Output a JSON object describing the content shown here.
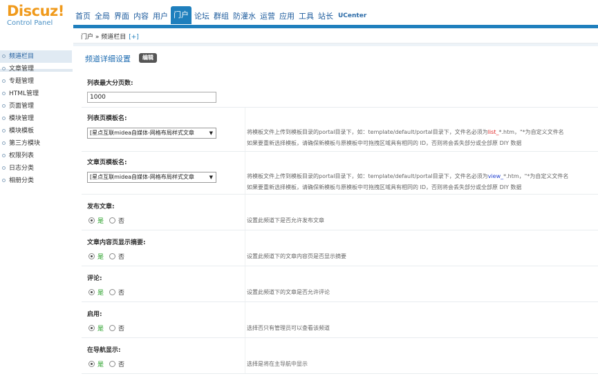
{
  "logo": {
    "text": "Discuz!",
    "subtitle": "Control Panel"
  },
  "topnav": [
    {
      "label": "首页",
      "active": false
    },
    {
      "label": "全局",
      "active": false
    },
    {
      "label": "界面",
      "active": false
    },
    {
      "label": "内容",
      "active": false
    },
    {
      "label": "用户",
      "active": false
    },
    {
      "label": "门户",
      "active": true
    },
    {
      "label": "论坛",
      "active": false
    },
    {
      "label": "群组",
      "active": false
    },
    {
      "label": "防灌水",
      "active": false
    },
    {
      "label": "运营",
      "active": false
    },
    {
      "label": "应用",
      "active": false
    },
    {
      "label": "工具",
      "active": false
    },
    {
      "label": "站长",
      "active": false
    },
    {
      "label": "UCenter",
      "active": false
    }
  ],
  "breadcrumb": {
    "text": "门户 » 频道栏目",
    "plus": "[+]"
  },
  "sidebar": {
    "items": [
      {
        "label": "频道栏目",
        "active": true
      },
      {
        "label": "文章管理"
      },
      {
        "label": "专题管理"
      },
      {
        "label": "HTML管理"
      },
      {
        "label": "页面管理"
      },
      {
        "label": "模块管理"
      },
      {
        "label": "模块模板"
      },
      {
        "label": "第三方模块"
      },
      {
        "label": "权限列表"
      },
      {
        "label": "日志分类"
      },
      {
        "label": "相册分类"
      }
    ]
  },
  "main": {
    "title": "频道详细设置",
    "edit_label": "编辑",
    "max_pages": {
      "label": "列表最大分页数:",
      "value": "1000"
    },
    "list_template": {
      "label": "列表页模板名:",
      "selected": "[星点互联midea自媒体-网格布局样式文章",
      "desc1_a": "将模板文件上传到模板目录的portal目录下，如：template/default/portal目录下，文件名必须为",
      "desc1_hl": "list_",
      "desc1_b": "*.htm，\"*为自定义文件名",
      "desc2": "如果要重新选择模板，请确保新模板与原模板中可拖拽区域具有相同的 ID，否则将会丢失部分或全部原 DIY 数据"
    },
    "article_template": {
      "label": "文章页模板名:",
      "selected": "[星点互联midea自媒体-网格布局样式文章",
      "desc1_a": "将模板文件上传到模板目录的portal目录下，如：template/default/portal目录下，文件名必须为",
      "desc1_hl": "view_",
      "desc1_b": "*.htm，\"*为自定义文件名",
      "desc2": "如果要重新选择模板，请确保新模板与原模板中可拖拽区域具有相同的 ID，否则将会丢失部分或全部原 DIY 数据"
    },
    "yes_label": "是",
    "no_label": "否",
    "radio_rows": [
      {
        "label": "发布文章:",
        "desc": "设置此频道下是否允许发布文章",
        "yes": true
      },
      {
        "label": "文章内容页显示摘要:",
        "desc": "设置此频道下的文章内容页是否显示摘要",
        "yes": true
      },
      {
        "label": "评论:",
        "desc": "设置此频道下的文章是否允许评论",
        "yes": true
      },
      {
        "label": "启用:",
        "desc": "选择否只有管理员可以查看该频道",
        "yes": true
      },
      {
        "label": "在导航显示:",
        "desc": "选择是将在主导航中显示",
        "yes": true
      }
    ]
  }
}
